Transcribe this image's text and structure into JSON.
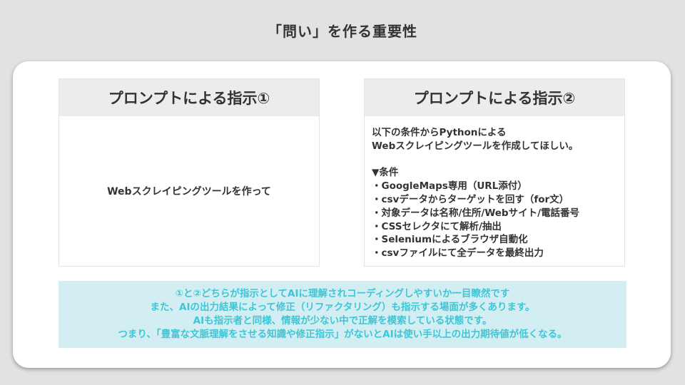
{
  "title": "「問い」を作る重要性",
  "left_panel": {
    "header": "プロンプトによる指示①",
    "body": "Webスクレイピングツールを作って"
  },
  "right_panel": {
    "header": "プロンプトによる指示②",
    "intro": [
      "以下の条件からPythonによる",
      "Webスクレイピングツールを作成してほしい。"
    ],
    "conditions_heading": "▼条件",
    "conditions": [
      "・GoogleMaps専用（URL添付）",
      "・csvデータからターゲットを回す（for文）",
      "・対象データは名称/住所/Webサイト/電話番号",
      "・CSSセレクタにて解析/抽出",
      "・Seleniumによるブラウザ自動化",
      "・csvファイルにて全データを最終出力"
    ]
  },
  "summary": [
    "①と②どちらが指示としてAIに理解されコーディングしやすいか一目瞭然です",
    "また、AIの出力結果によって修正（リファクタリング）も指示する場面が多くあります。",
    "AIも指示者と同様、情報が少ない中で正解を模索している状態です。",
    "つまり、「豊富な文脈理解をさせる知識や修正指示」がないとAIは使い手以上の出力期待値が低くなる。"
  ],
  "colors": {
    "background": "#e2e2e2",
    "card": "#ffffff",
    "panel_header": "#ececec",
    "summary_background": "#d3eef3",
    "summary_text": "#3ec6d6",
    "text": "#333333"
  }
}
